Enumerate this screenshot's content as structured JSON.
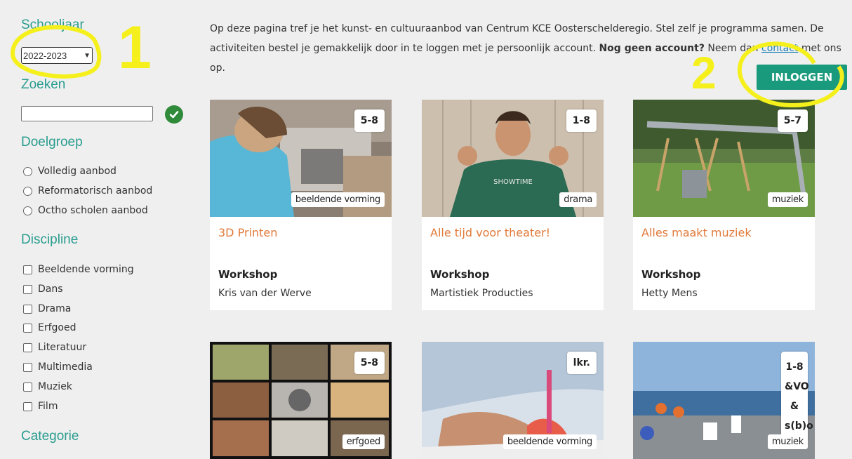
{
  "sidebar": {
    "schooljaar_title": "Schooljaar",
    "schooljaar_value": "2022-2023",
    "zoeken_title": "Zoeken",
    "doelgroep_title": "Doelgroep",
    "doelgroep_options": [
      "Volledig aanbod",
      "Reformatorisch aanbod",
      "Octho scholen aanbod"
    ],
    "discipline_title": "Discipline",
    "discipline_options": [
      "Beeldende vorming",
      "Dans",
      "Drama",
      "Erfgoed",
      "Literatuur",
      "Multimedia",
      "Muziek",
      "Film"
    ],
    "categorie_title": "Categorie"
  },
  "intro": {
    "text1": "Op deze pagina tref je het kunst- en cultuuraanbod van Centrum KCE Oosterscheldere­gio. Stel zelf je programma samen. De activiteiten bestel je gemakkelijk door in te loggen met je persoonlijk account. ",
    "bold": "Nog geen account?",
    "text2": " Neem dan ",
    "link": "contact",
    "text3": " met ons op."
  },
  "login_label": "INLOGGEN",
  "cards": [
    {
      "badge": "5-8",
      "discipline": "beeldende vorming",
      "title": "3D Printen",
      "kind": "Workshop",
      "who": "Kris van der Werve"
    },
    {
      "badge": "1-8",
      "discipline": "drama",
      "title": "Alle tijd voor theater!",
      "kind": "Workshop",
      "who": "Martistiek Producties"
    },
    {
      "badge": "5-7",
      "discipline": "muziek",
      "title": "Alles maakt muziek",
      "kind": "Workshop",
      "who": "Hetty Mens"
    },
    {
      "badge": "5-8",
      "discipline": "erfgoed"
    },
    {
      "badge": "lkr.",
      "discipline": "beeldende vorming"
    },
    {
      "badge": "1-8 &VO & s(b)o",
      "discipline": "muziek"
    }
  ],
  "annotations": {
    "one": "1",
    "two": "2"
  },
  "colors": {
    "accent": "#2a9d8f",
    "title_orange": "#e07a3a",
    "login_green": "#1a9a7d",
    "annotation_yellow": "#f5f01c"
  }
}
